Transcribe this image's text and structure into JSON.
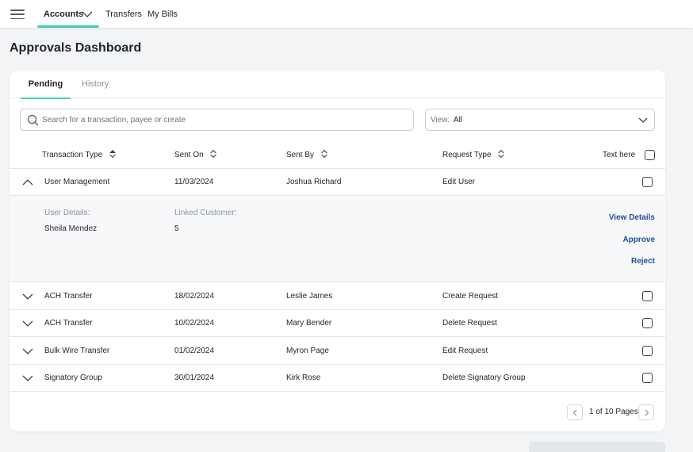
{
  "nav": {
    "items": [
      {
        "label": "Accounts"
      },
      {
        "label": "Transfers"
      },
      {
        "label": "My Bills"
      }
    ]
  },
  "page": {
    "title": "Approvals Dashboard"
  },
  "tabs": [
    {
      "label": "Pending",
      "active": true
    },
    {
      "label": "History",
      "active": false
    }
  ],
  "search": {
    "placeholder": "Search for a transaction, payee or create",
    "value": ""
  },
  "view": {
    "label": "View:",
    "value": "All"
  },
  "table": {
    "columns": [
      "Transaction Type",
      "Sent On",
      "Sent By",
      "Request Type",
      "Text here"
    ],
    "rows": [
      {
        "type": "User Management",
        "sent_on": "11/03/2024",
        "sent_by": "Joshua Richard",
        "request_type": "Edit User",
        "expanded": true
      },
      {
        "type": "ACH Transfer",
        "sent_on": "18/02/2024",
        "sent_by": "Leslie James",
        "request_type": "Create Request",
        "expanded": false
      },
      {
        "type": "ACH Transfer",
        "sent_on": "10/02/2024",
        "sent_by": "Mary Bender",
        "request_type": "Delete Request",
        "expanded": false
      },
      {
        "type": "Bulk Wire Transfer",
        "sent_on": "01/02/2024",
        "sent_by": "Myron Page",
        "request_type": "Edit Request",
        "expanded": false
      },
      {
        "type": "Signatory Group",
        "sent_on": "30/01/2024",
        "sent_by": "Kirk Rose",
        "request_type": "Delete Signatory Group",
        "expanded": false
      }
    ]
  },
  "expanded_details": {
    "user_details_label": "User Details:",
    "user_details_value": "Sheila Mendez",
    "linked_customer_label": "Linked Customer:",
    "linked_customer_value": "5",
    "actions": [
      "View Details",
      "Approve",
      "Reject"
    ]
  },
  "pagination": {
    "text": "1 of 10 Pages"
  },
  "colors": {
    "accent": "#3fd1b3",
    "link": "#1b4f9c",
    "background": "#f2f4f6"
  },
  "icons": [
    "menu-icon",
    "chevron-down-icon",
    "search-icon",
    "sort-icon",
    "chevron-up-icon",
    "chevron-left-icon",
    "chevron-right-icon"
  ]
}
